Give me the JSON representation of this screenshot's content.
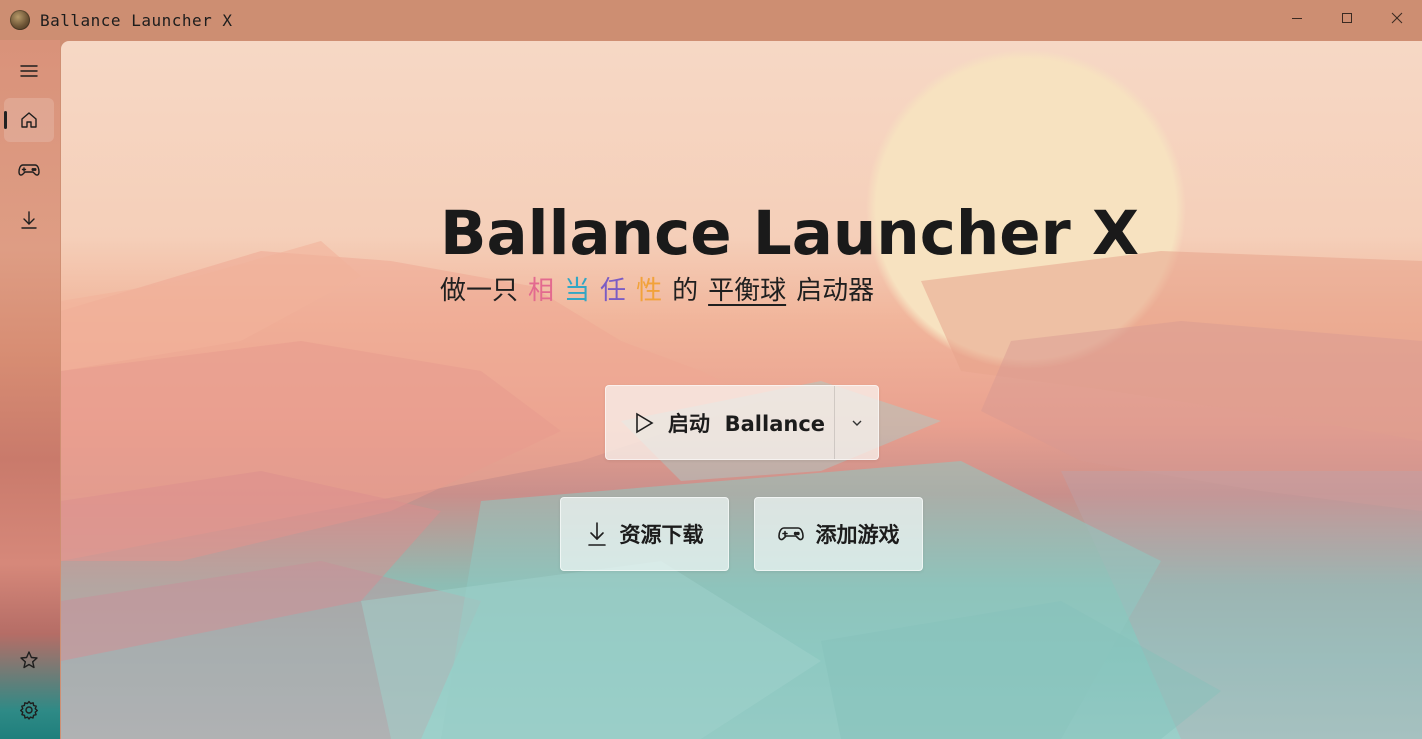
{
  "window": {
    "title": "Ballance Launcher X",
    "icon": "app-ball-icon",
    "controls": [
      "minimize-icon",
      "maximize-icon",
      "close-icon"
    ]
  },
  "sidebar": {
    "top": [
      {
        "icon": "hamburger-menu-icon",
        "active": false
      },
      {
        "icon": "home-icon",
        "active": true
      },
      {
        "icon": "gamepad-icon",
        "active": false
      },
      {
        "icon": "download-icon",
        "active": false
      }
    ],
    "bottom": [
      {
        "icon": "star-icon"
      },
      {
        "icon": "gear-icon"
      }
    ]
  },
  "hero": {
    "title": "Ballance Launcher X",
    "subtitle": {
      "w1": "做一只",
      "w2": "相",
      "w3": "当",
      "w4": "任",
      "w5": "性",
      "w6": "的",
      "w7": "平衡球",
      "w8": "启动器"
    },
    "colors": {
      "w2": "#e36a8f",
      "w3": "#33a6c4",
      "w4": "#7b5cc4",
      "w5": "#f2a23a"
    }
  },
  "actions": {
    "launch_label": "启动  Ballance",
    "download_label": "资源下载",
    "add_game_label": "添加游戏"
  }
}
